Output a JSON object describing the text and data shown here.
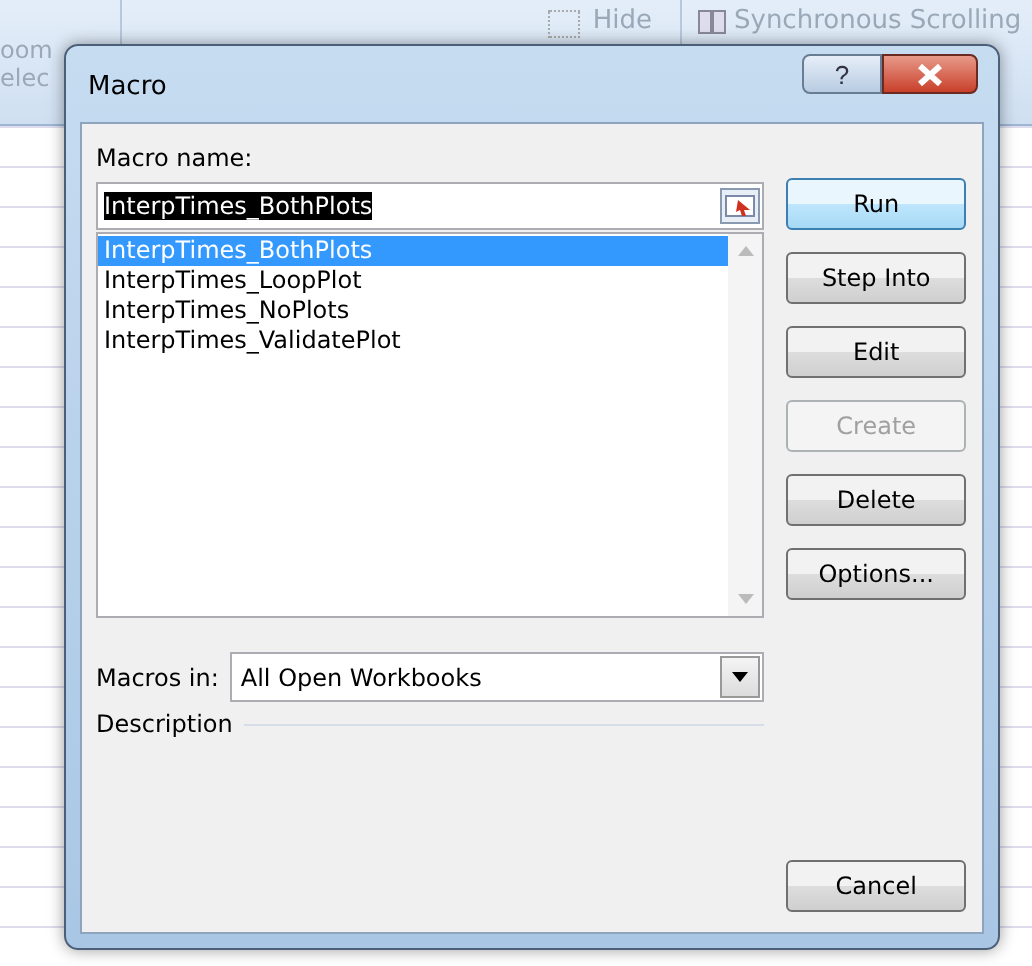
{
  "background": {
    "ribbon_texts": [
      "oom",
      "elec",
      "Hide",
      "Synchronous Scrolling"
    ]
  },
  "window": {
    "title": "Macro",
    "help": "?"
  },
  "macro_name": {
    "label": "Macro name:",
    "value": "InterpTimes_BothPlots"
  },
  "macros": [
    {
      "name": "InterpTimes_BothPlots",
      "selected": true
    },
    {
      "name": "InterpTimes_LoopPlot",
      "selected": false
    },
    {
      "name": "InterpTimes_NoPlots",
      "selected": false
    },
    {
      "name": "InterpTimes_ValidatePlot",
      "selected": false
    }
  ],
  "buttons": [
    {
      "label": "Run",
      "disabled": false,
      "default": true
    },
    {
      "label": "Step Into",
      "disabled": false,
      "default": false
    },
    {
      "label": "Edit",
      "disabled": false,
      "default": false
    },
    {
      "label": "Create",
      "disabled": true,
      "default": false
    },
    {
      "label": "Delete",
      "disabled": false,
      "default": false
    },
    {
      "label": "Options...",
      "disabled": false,
      "default": false
    }
  ],
  "macros_in": {
    "label": "Macros in:",
    "value": "All Open Workbooks"
  },
  "description": {
    "label": "Description"
  },
  "cancel": {
    "label": "Cancel"
  }
}
